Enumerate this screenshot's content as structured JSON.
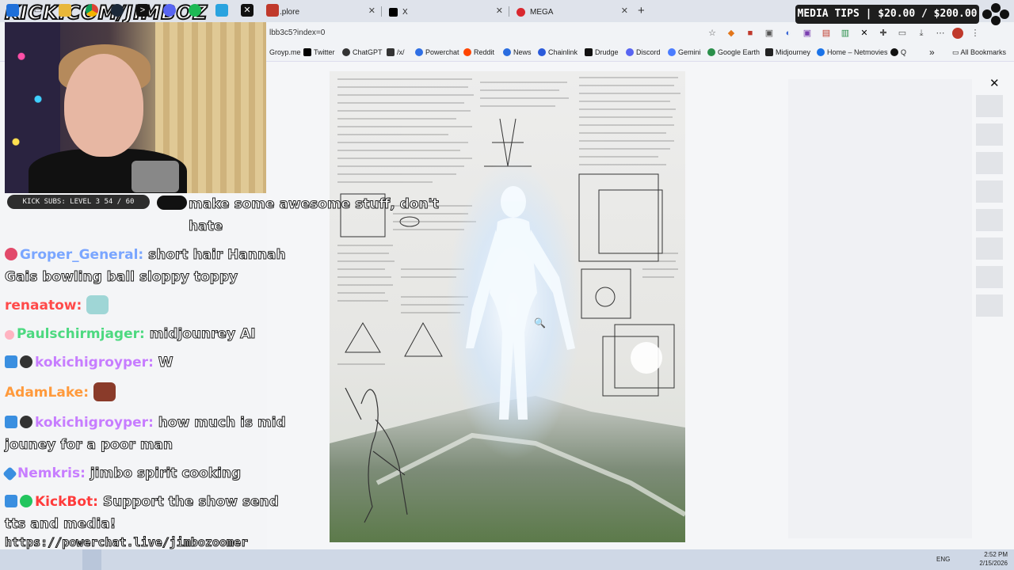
{
  "overlay": {
    "logo": "KICK.COM/JIMBOZ",
    "subs_label": "KICK SUBS: LEVEL 3 54 / 60",
    "media_tips": "MEDIA TIPS | $20.00 / $200.00",
    "link": "https://powerchat.live/jimbozoomer"
  },
  "chat": [
    {
      "user": "",
      "text": "make some awesome stuff, don't hate",
      "user_color": "#ffffff"
    },
    {
      "user": "Groper_General:",
      "text": "short hair Hannah Gais bowling ball sloppy toppy",
      "user_color": "#7aa6ff"
    },
    {
      "user": "renaatow:",
      "text": "",
      "user_color": "#ff4a4a"
    },
    {
      "user": "Paulschirmjager:",
      "text": "midjounrey AI",
      "user_color": "#4dd980"
    },
    {
      "user": "kokichigroyper:",
      "text": "W",
      "user_color": "#c77dff"
    },
    {
      "user": "AdamLake:",
      "text": "",
      "user_color": "#ff9a3c"
    },
    {
      "user": "kokichigroyper:",
      "text": "how much is mid jouney for a poor man",
      "user_color": "#c77dff"
    },
    {
      "user": "Nemkris:",
      "text": "jimbo spirit cooking",
      "user_color": "#c77dff"
    },
    {
      "user": "KickBot:",
      "text": "Support the show send tts and media!",
      "user_color": "#ff3b3b"
    }
  ],
  "browser": {
    "tabs": [
      {
        "label": ".plore",
        "favicon_color": "#cccccc"
      },
      {
        "label": "X",
        "favicon_color": "#000000"
      },
      {
        "label": "MEGA",
        "favicon_color": "#d9272e"
      }
    ],
    "new_tab": "+",
    "url": "lbb3c5?index=0",
    "bookmarks": [
      {
        "label": "Groyp.me",
        "color": "#888888"
      },
      {
        "label": "Twitter",
        "color": "#000000"
      },
      {
        "label": "ChatGPT",
        "color": "#333333"
      },
      {
        "label": "/x/",
        "color": "#333333"
      },
      {
        "label": "Powerchat",
        "color": "#2f6fe4"
      },
      {
        "label": "Reddit",
        "color": "#ff4500"
      },
      {
        "label": "News",
        "color": "#2a6de0"
      },
      {
        "label": "Chainlink",
        "color": "#2a5ada"
      },
      {
        "label": "Drudge",
        "color": "#111111"
      },
      {
        "label": "Discord",
        "color": "#5865f2"
      },
      {
        "label": "Gemini",
        "color": "#4a7cff"
      },
      {
        "label": "Google Earth",
        "color": "#2a8f4a"
      },
      {
        "label": "Midjourney",
        "color": "#222222"
      },
      {
        "label": "Home – Netmovies",
        "color": "#1a73e8"
      },
      {
        "label": "Q",
        "color": "#111111"
      }
    ],
    "more": "»",
    "all_bookmarks": "All Bookmarks"
  },
  "viewer": {
    "close_icon": "close-icon"
  },
  "taskbar": {
    "lang": "ENG",
    "time": "2:52 PM",
    "date": "2/15/2026"
  }
}
